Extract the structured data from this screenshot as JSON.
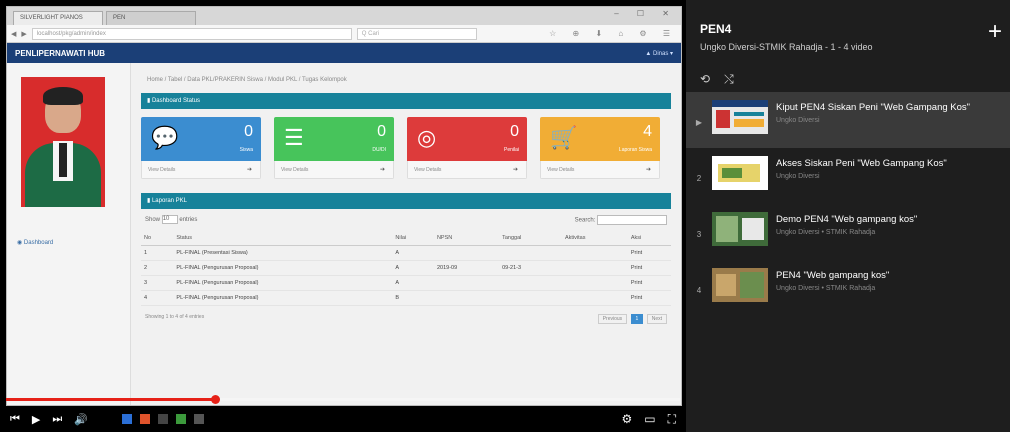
{
  "browser": {
    "tabs": [
      "SILVERLIGHT PIANOS",
      "PEN"
    ],
    "address": "localhost/pkg/admin/index",
    "search_placeholder": "Q  Cari",
    "window_controls": "– ☐ ✕",
    "toolbar_icons": "☆ ⊕ ⬇ ⌂ ⚙ ☰"
  },
  "app": {
    "brand": "PENLIPERNAWATI HUB",
    "user_label": "▲ Dinas ▾",
    "sidebar_link": "◉ Dashboard",
    "breadcrumb": "Home / Tabel / Data PKL/PRAKERIN Siswa / Modul PKL / Tugas Kelompok",
    "dashboard_header": "▮ Dashboard Status",
    "stats": [
      {
        "value": "0",
        "label": "Siswa",
        "footer": "View Details",
        "color": "#3b8dd0"
      },
      {
        "value": "0",
        "label": "DU/DI",
        "footer": "View Details",
        "color": "#47c45b"
      },
      {
        "value": "0",
        "label": "Penilai",
        "footer": "View Details",
        "color": "#dd3b3b"
      },
      {
        "value": "4",
        "label": "Laporan Siswa",
        "footer": "View Details",
        "color": "#f1ad35"
      }
    ],
    "table_header": "▮ Laporan PKL",
    "show_label": "Show",
    "show_value": "10",
    "entries_label": "entries",
    "search_label": "Search:",
    "columns": [
      "No",
      "Status",
      "Nilai",
      "NPSN",
      "Tanggal",
      "Aktivitas",
      "Aksi"
    ],
    "rows": [
      {
        "no": "1",
        "status": "PL-FINAL (Presentasi Siswa)",
        "nilai": "A",
        "npsn": "",
        "tanggal": "",
        "aktivitas": "",
        "aksi": "Print"
      },
      {
        "no": "2",
        "status": "PL-FINAL (Pengurusan Proposal)",
        "nilai": "A",
        "npsn": "2019-09",
        "tanggal": "09-21-3",
        "aktivitas": "",
        "aksi": "Print"
      },
      {
        "no": "3",
        "status": "PL-FINAL (Pengurusan Proposal)",
        "nilai": "A",
        "npsn": "",
        "tanggal": "",
        "aktivitas": "",
        "aksi": "Print"
      },
      {
        "no": "4",
        "status": "PL-FINAL (Pengurusan Proposal)",
        "nilai": "B",
        "npsn": "",
        "tanggal": "",
        "aktivitas": "",
        "aksi": "Print"
      }
    ],
    "showing_text": "Showing 1 to 4 of 4 entries",
    "pager": {
      "prev": "Previous",
      "current": "1",
      "next": "Next"
    }
  },
  "player": {
    "progress": 0.31,
    "time": "",
    "accent": "#e62117"
  },
  "playlist": {
    "title": "PEN4",
    "subtitle": "Ungko Diversi-STMIK Rahadja - 1 - 4 video",
    "add_icon": "+",
    "items": [
      {
        "index": "▶",
        "title": "Kiput PEN4 Siskan Peni \"Web Gampang Kos\"",
        "meta": "Ungko Diversi",
        "active": true
      },
      {
        "index": "2",
        "title": "Akses Siskan Peni \"Web Gampang Kos\"",
        "meta": "Ungko Diversi",
        "active": false
      },
      {
        "index": "3",
        "title": "Demo PEN4 \"Web gampang kos\"",
        "meta": "Ungko Diversi • STMIK Rahadja",
        "active": false
      },
      {
        "index": "4",
        "title": "PEN4 \"Web gampang kos\"",
        "meta": "Ungko Diversi • STMIK Rahadja",
        "active": false
      }
    ]
  }
}
